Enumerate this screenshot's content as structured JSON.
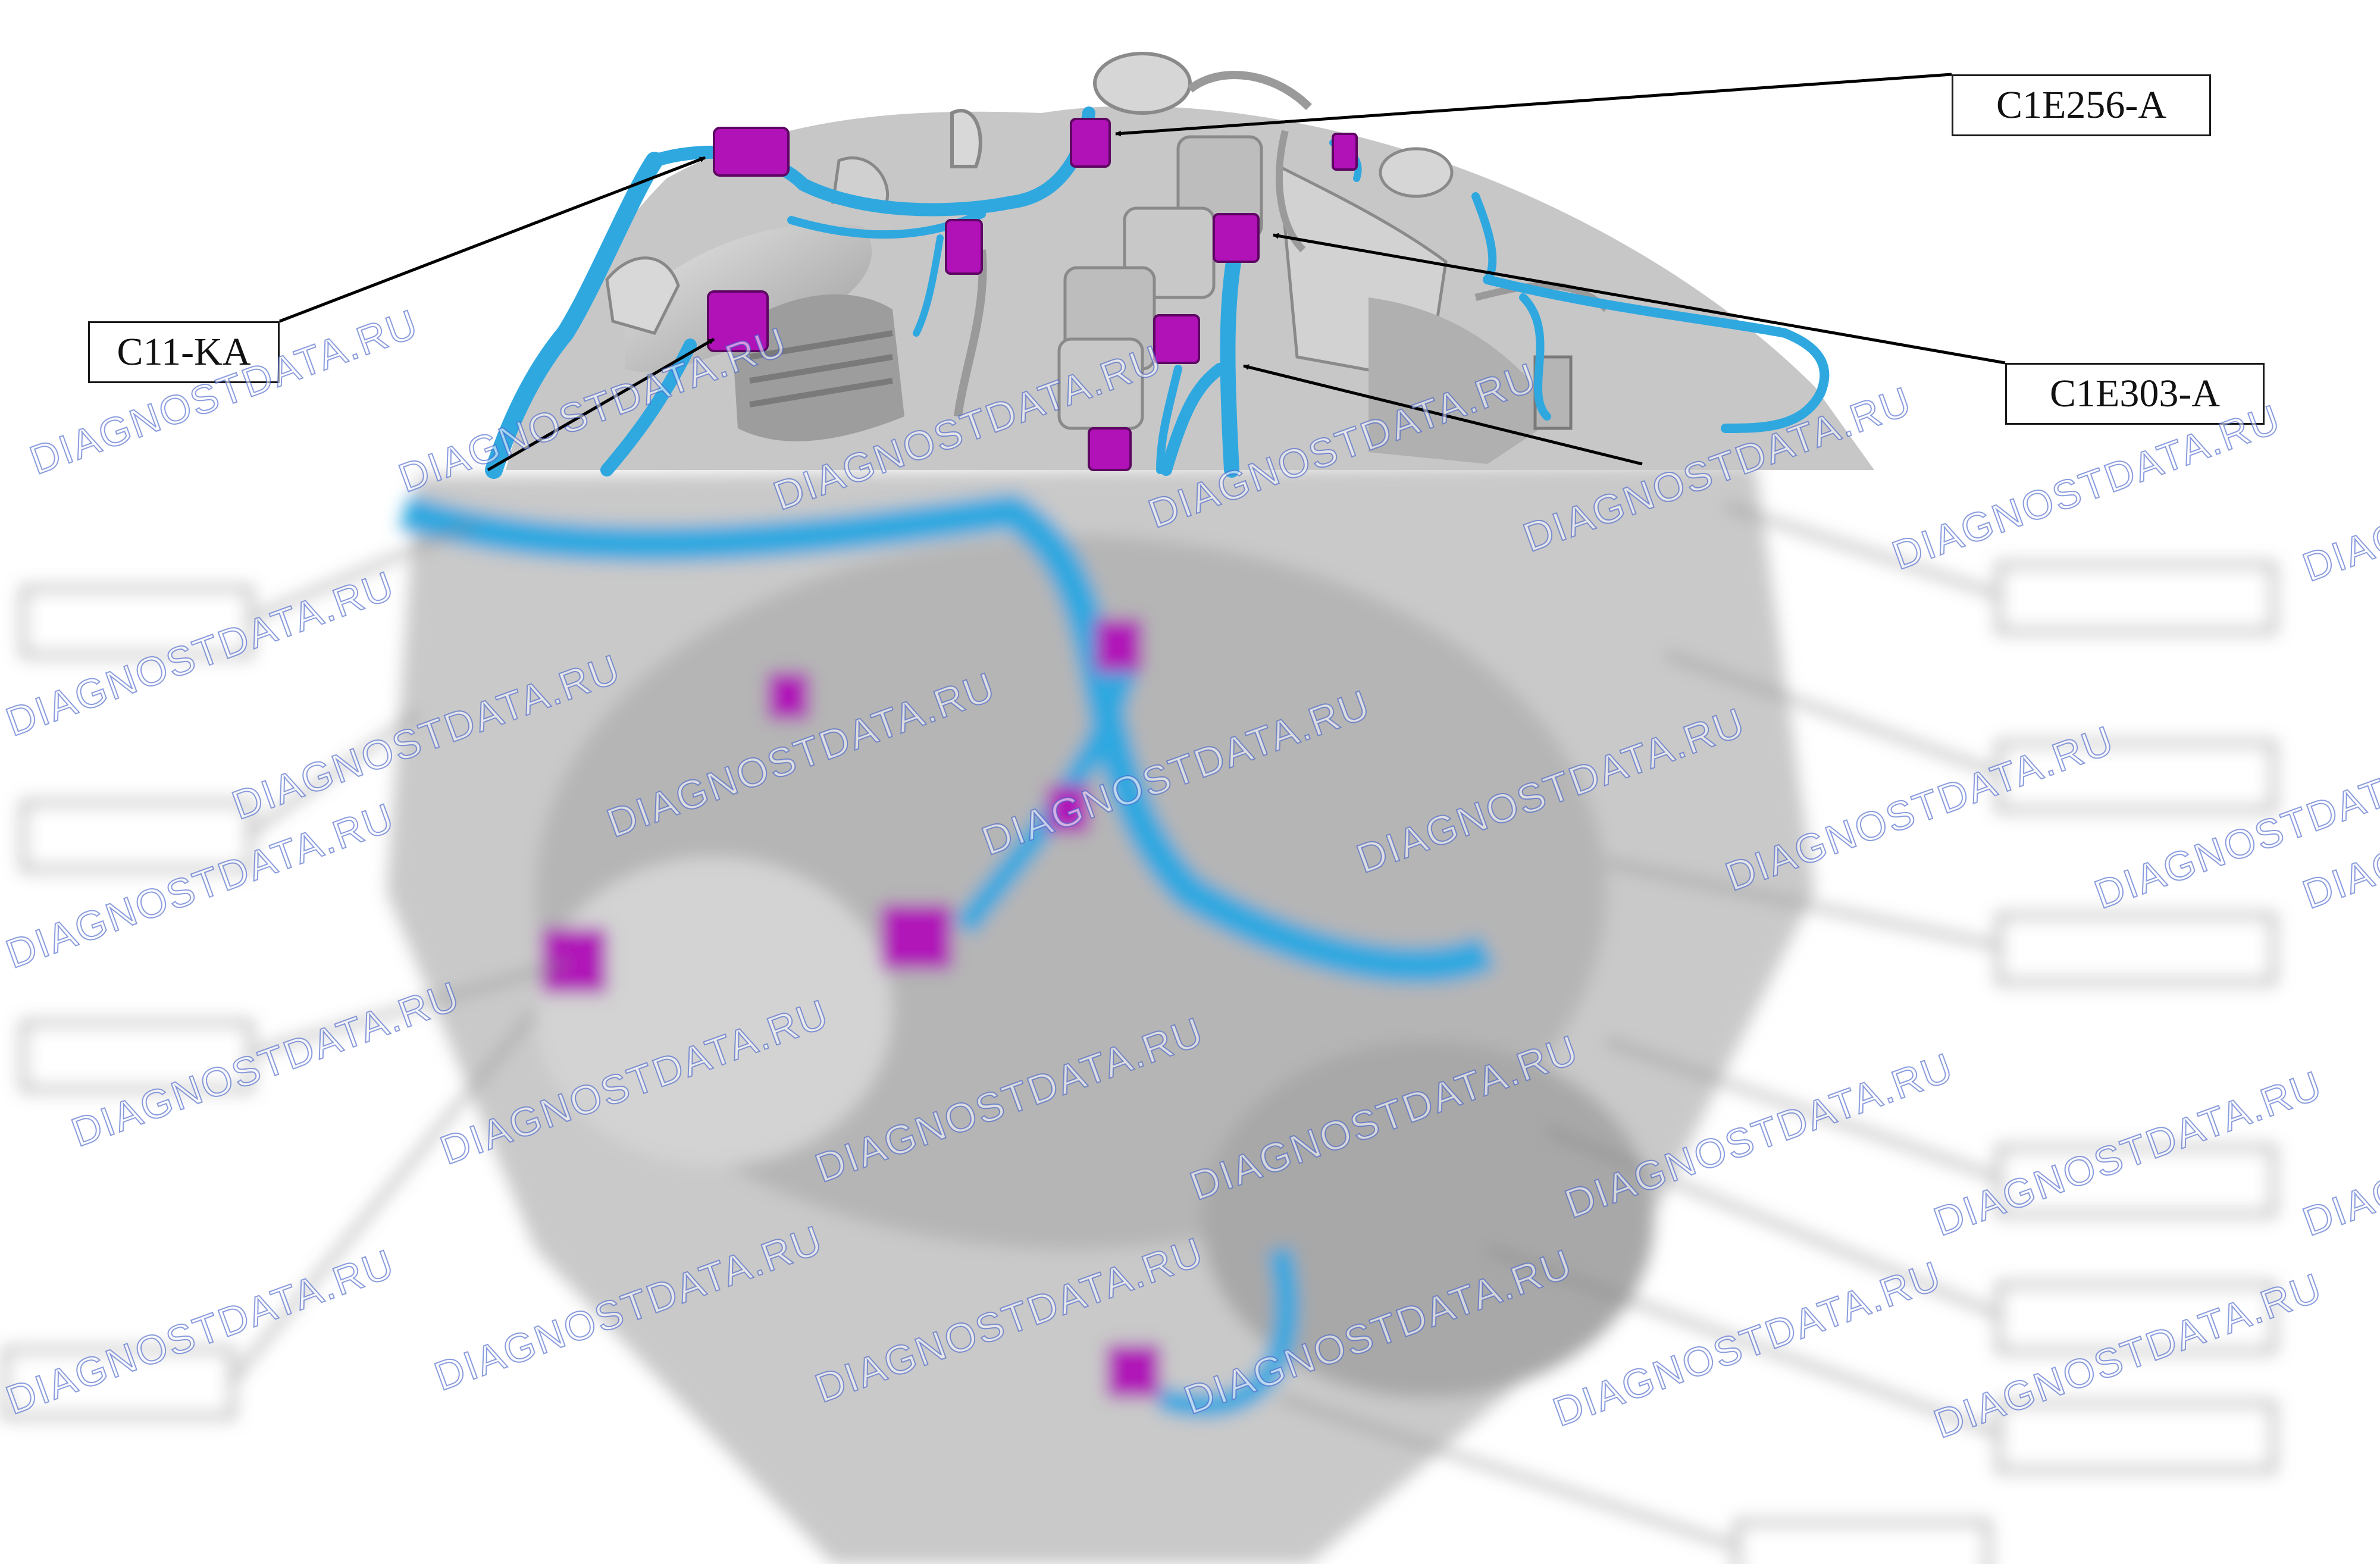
{
  "connectors": {
    "c1e256a": "C1E256-A",
    "c11ka": "C11-KA",
    "c1e303a": "C1E303-A"
  },
  "watermark": "DIAGNOSTDATA.RU",
  "colors": {
    "harness": "#2fa8e0",
    "connector": "#b012b8",
    "engine": "#bfbfbf"
  }
}
